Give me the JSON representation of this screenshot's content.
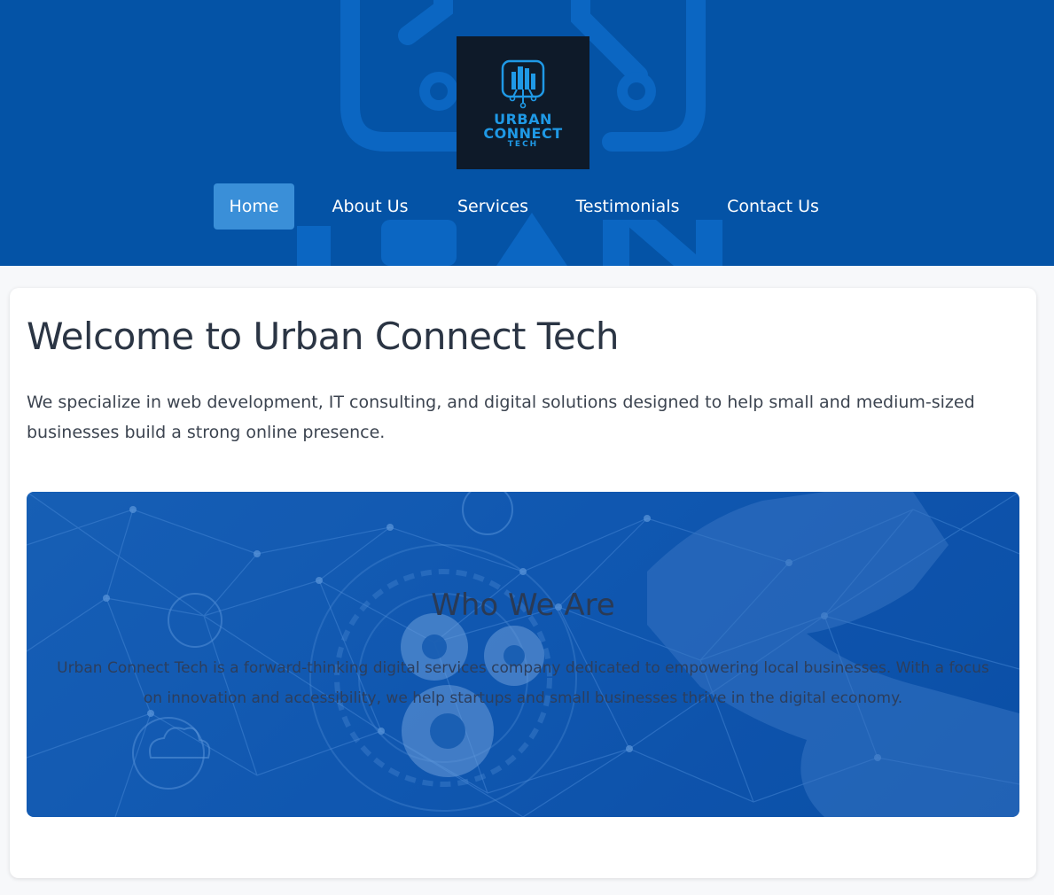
{
  "header": {
    "logo": {
      "line1": "URBAN",
      "line2": "CONNECT",
      "line3": "TECH"
    },
    "nav": [
      {
        "label": "Home",
        "active": true
      },
      {
        "label": "About Us",
        "active": false
      },
      {
        "label": "Services",
        "active": false
      },
      {
        "label": "Testimonials",
        "active": false
      },
      {
        "label": "Contact Us",
        "active": false
      }
    ]
  },
  "main": {
    "title": "Welcome to Urban Connect Tech",
    "intro": "We specialize in web development, IT consulting, and digital solutions designed to help small and medium-sized businesses build a strong online presence.",
    "banner": {
      "title": "Who We Are",
      "text": "Urban Connect Tech is a forward-thinking digital services company dedicated to empowering local businesses. With a focus on innovation and accessibility, we help startups and small businesses thrive in the digital economy."
    }
  },
  "colors": {
    "header_bg": "#0453a6",
    "nav_active": "#3a8fd8",
    "logo_bg": "#0e1a29",
    "logo_accent": "#1f99e6",
    "title_text": "#2b3544"
  }
}
